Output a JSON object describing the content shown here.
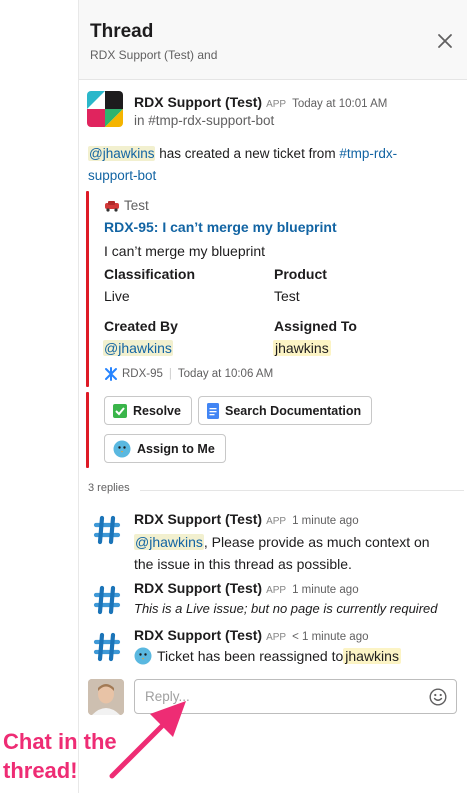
{
  "thread": {
    "title": "Thread",
    "subtitle": "RDX Support (Test) and"
  },
  "parent": {
    "author": "RDX Support (Test)",
    "badge": "APP",
    "time": "Today at 10:01 AM",
    "channel": "in #tmp-rdx-support-bot",
    "mention": "@jhawkins",
    "text": " has created a new ticket from ",
    "channel_link": "#tmp-rdx-",
    "channel_link2": "support-bot",
    "attachment": {
      "pretext": "Test",
      "title": "RDX-95: I can’t merge my blueprint",
      "description": "I can’t merge my blueprint",
      "fields": [
        {
          "label": "Classification",
          "value": "Live"
        },
        {
          "label": "Product",
          "value": "Test"
        },
        {
          "label": "Created By",
          "value": "@jhawkins"
        },
        {
          "label": "Assigned To",
          "value": "jhawkins"
        }
      ],
      "footer_id": "RDX-95",
      "footer_time": "Today at 10:06 AM"
    },
    "actions": {
      "resolve": "Resolve",
      "search_docs": "Search Documentation",
      "assign": "Assign to Me"
    }
  },
  "replies_label": "3 replies",
  "replies": [
    {
      "author": "RDX Support (Test)",
      "badge": "APP",
      "time": "1 minute ago",
      "mention": "@jhawkins",
      "text1": ", Please provide as much context on",
      "text2": "the issue in this thread as possible."
    },
    {
      "author": "RDX Support (Test)",
      "badge": "APP",
      "time": "1 minute ago",
      "text": "This is a Live issue; but no page is currently required"
    },
    {
      "author": "RDX Support (Test)",
      "badge": "APP",
      "time": "< 1 minute ago",
      "text": "Ticket has been reassigned to ",
      "mention": "jhawkins"
    }
  ],
  "composer": {
    "placeholder": "Reply..."
  },
  "annotation": {
    "line1": "Chat in the",
    "line2": "thread!"
  },
  "colors": {
    "accent_red": "#de1a26",
    "link_blue": "#1264a3",
    "annotation_pink": "#ee2c74"
  }
}
